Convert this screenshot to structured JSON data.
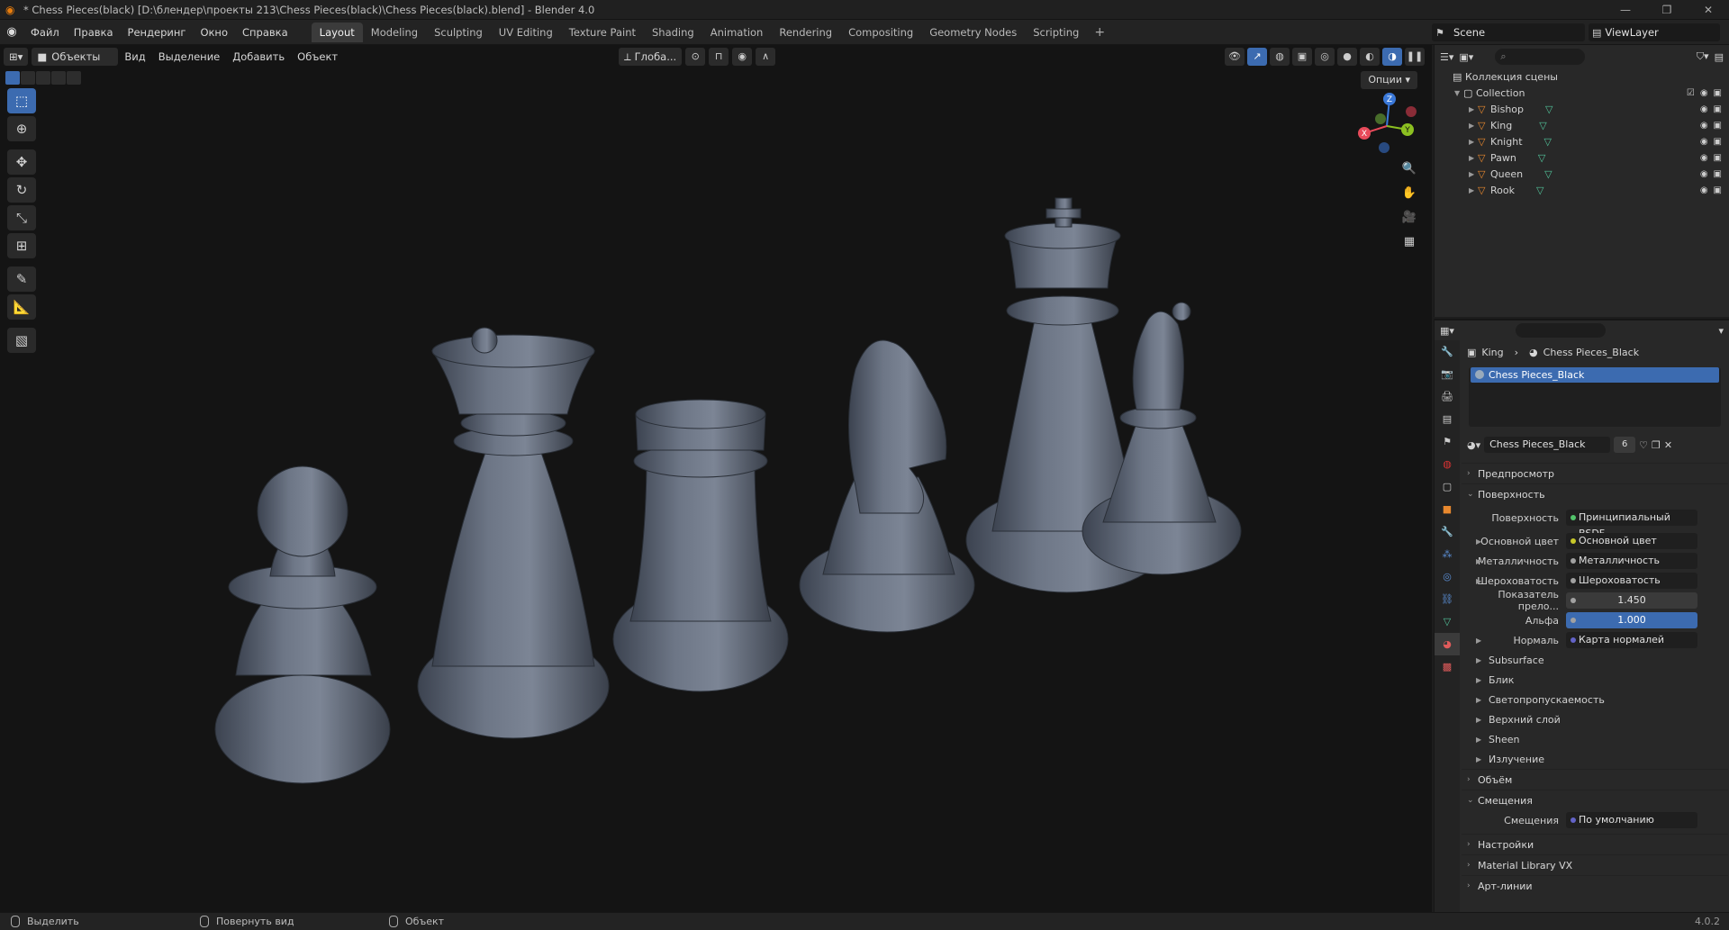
{
  "window": {
    "title": "* Chess Pieces(black) [D:\\блендер\\проекты 213\\Chess Pieces(black)\\Chess Pieces(black).blend] - Blender 4.0"
  },
  "menu": {
    "items": [
      "Файл",
      "Правка",
      "Рендеринг",
      "Окно",
      "Справка"
    ]
  },
  "workspaces": {
    "tabs": [
      "Layout",
      "Modeling",
      "Sculpting",
      "UV Editing",
      "Texture Paint",
      "Shading",
      "Animation",
      "Rendering",
      "Compositing",
      "Geometry Nodes",
      "Scripting"
    ],
    "active": "Layout"
  },
  "scene": {
    "name": "Scene",
    "view_layer": "ViewLayer"
  },
  "viewport": {
    "mode": "Объекты",
    "menus": [
      "Вид",
      "Выделение",
      "Добавить",
      "Объект"
    ],
    "orientation": "Глоба...",
    "options_label": "Опции",
    "gizmo": {
      "x": "X",
      "y": "Y",
      "z": "Z"
    }
  },
  "outliner": {
    "root": "Коллекция сцены",
    "collection": "Collection",
    "objects": [
      "Bishop",
      "King",
      "Knight",
      "Pawn",
      "Queen",
      "Rook"
    ]
  },
  "properties": {
    "breadcrumb_object": "King",
    "breadcrumb_material": "Chess Pieces_Black",
    "slot": "Chess Pieces_Black",
    "material_name": "Chess Pieces_Black",
    "material_users": "6",
    "panels": {
      "preview": "Предпросмотр",
      "surface": "Поверхность",
      "volume": "Объём",
      "displacement": "Смещения",
      "settings": "Настройки",
      "material_library": "Material Library VX",
      "line_art": "Арт-линии"
    },
    "surface_rows": [
      {
        "label": "Поверхность",
        "value": "Принципиальный BSDF",
        "color": "#52c36a"
      },
      {
        "label": "Основной цвет",
        "value": "Основной цвет",
        "color": "#c7c729"
      },
      {
        "label": "Металличность",
        "value": "Металличность",
        "color": "#a1a1a1"
      },
      {
        "label": "Шероховатость",
        "value": "Шероховатость",
        "color": "#a1a1a1"
      },
      {
        "label": "Показатель прело...",
        "value": "1.450",
        "color": "#a1a1a1"
      },
      {
        "label": "Альфа",
        "value": "1.000",
        "color": "#a1a1a1"
      },
      {
        "label": "Нормаль",
        "value": "Карта нормалей",
        "color": "#6363c7"
      }
    ],
    "subsections": [
      "Subsurface",
      "Блик",
      "Светопропускаемость",
      "Верхний слой",
      "Sheen",
      "Излучение"
    ],
    "displacement_row": {
      "label": "Смещения",
      "value": "По умолчанию",
      "color": "#6363c7"
    }
  },
  "status": {
    "left": "Выделить",
    "middle": "Повернуть вид",
    "right": "Объект",
    "version": "4.0.2"
  },
  "colors": {
    "accent_blue": "#3c6bb0",
    "object_orange": "#e8882e",
    "mesh_green": "#52c39a",
    "piece_gray": "#5f6878"
  }
}
